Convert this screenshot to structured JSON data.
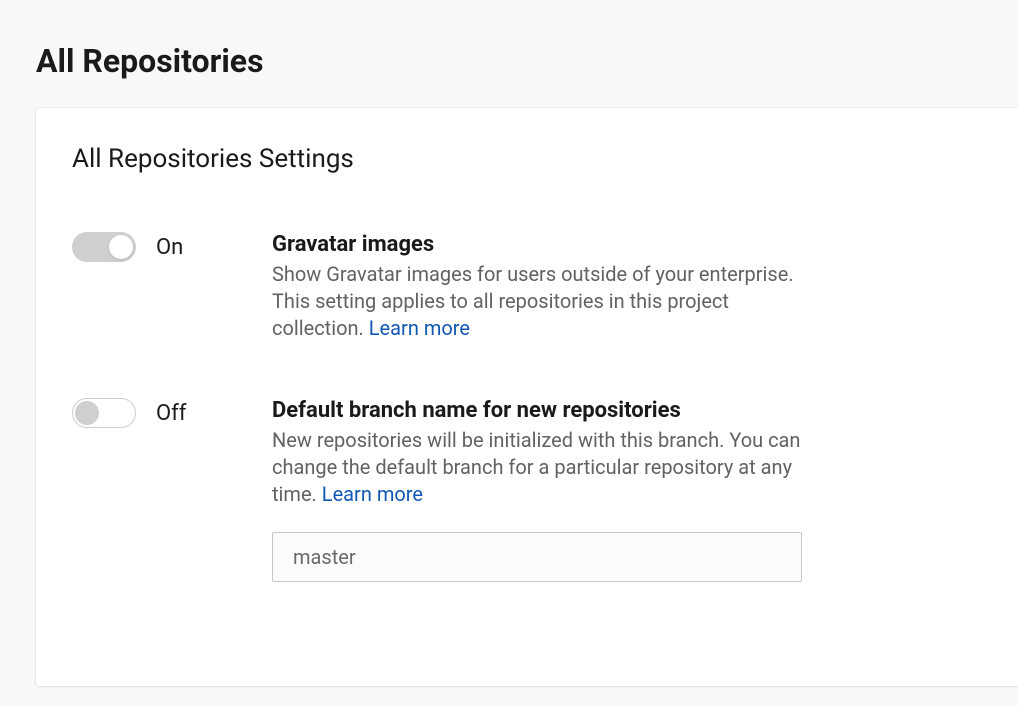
{
  "page": {
    "title": "All Repositories"
  },
  "card": {
    "title": "All Repositories Settings"
  },
  "settings": {
    "gravatar": {
      "toggle_state": "On",
      "title": "Gravatar images",
      "description": "Show Gravatar images for users outside of your enterprise. This setting applies to all repositories in this project collection. ",
      "learn_more": "Learn more"
    },
    "default_branch": {
      "toggle_state": "Off",
      "title": "Default branch name for new repositories",
      "description": "New repositories will be initialized with this branch. You can change the default branch for a particular repository at any time. ",
      "learn_more": "Learn more",
      "input_value": "master",
      "input_placeholder": "master"
    }
  }
}
